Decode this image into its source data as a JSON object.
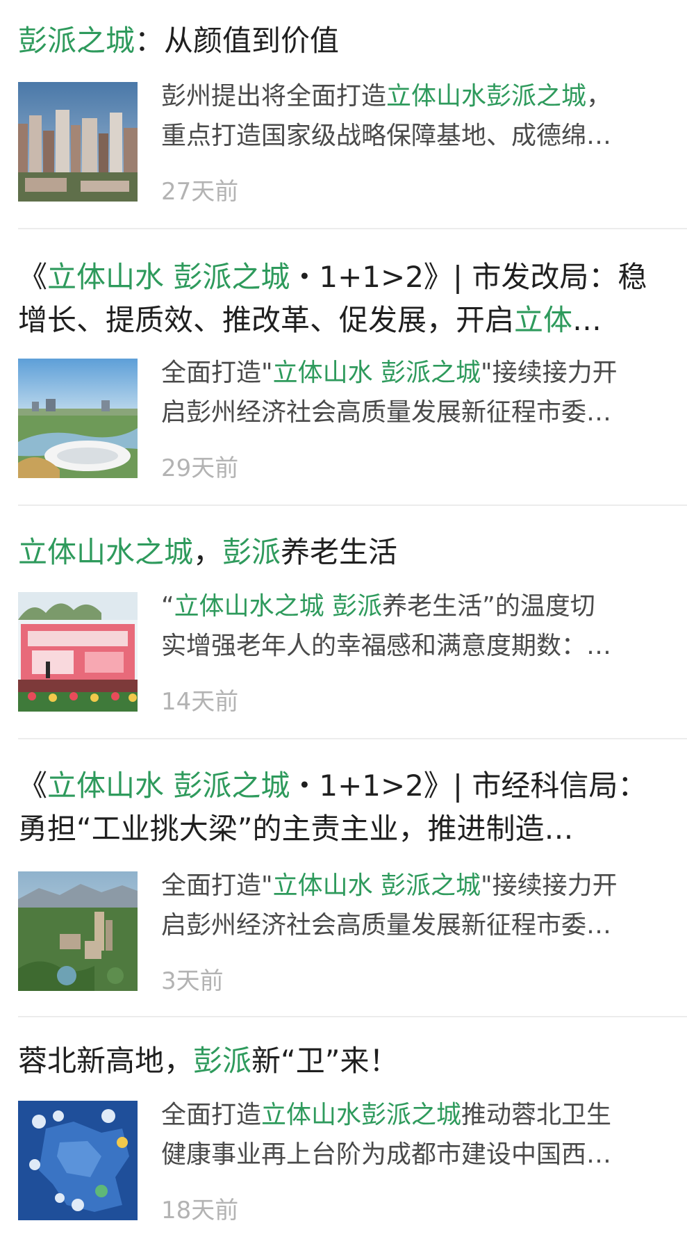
{
  "articles": [
    {
      "title_line1": [
        {
          "text": "彭派之城",
          "hl": true
        },
        {
          "text": "：从颜值到价值",
          "hl": false
        }
      ],
      "title_line2": [],
      "summary_line1": [
        {
          "text": "彭州提出将全面打造",
          "hl": false
        },
        {
          "text": "立体山水彭派之城",
          "hl": true
        },
        {
          "text": "，",
          "hl": false
        }
      ],
      "summary_line2": [
        {
          "text": "重点打造国家级战略保障基地、成德绵…",
          "hl": false
        }
      ],
      "time": "27天前",
      "thumb": "city-skyline-image"
    },
    {
      "title_line1": [
        {
          "text": "《",
          "hl": false
        },
        {
          "text": "立体山水 彭派之城",
          "hl": true
        },
        {
          "text": "・1+1>2》| 市发改局：稳",
          "hl": false
        }
      ],
      "title_line2": [
        {
          "text": "增长、提质效、推改革、促发展，开启",
          "hl": false
        },
        {
          "text": "立体",
          "hl": true
        },
        {
          "text": "…",
          "hl": false
        }
      ],
      "summary_line1": [
        {
          "text": "全面打造\"",
          "hl": false
        },
        {
          "text": "立体山水 彭派之城",
          "hl": true
        },
        {
          "text": "\"接续接力开",
          "hl": false
        }
      ],
      "summary_line2": [
        {
          "text": "启彭州经济社会高质量发展新征程市委…",
          "hl": false
        }
      ],
      "time": "29天前",
      "thumb": "stadium-aerial-image"
    },
    {
      "title_line1": [
        {
          "text": "立体山水之城",
          "hl": true
        },
        {
          "text": "，",
          "hl": false
        },
        {
          "text": "彭派",
          "hl": true
        },
        {
          "text": "养老生活",
          "hl": false
        }
      ],
      "title_line2": [],
      "summary_line1": [
        {
          "text": "“",
          "hl": false
        },
        {
          "text": "立体山水之城 彭派",
          "hl": true
        },
        {
          "text": "养老生活”的温度切",
          "hl": false
        }
      ],
      "summary_line2": [
        {
          "text": "实增强老年人的幸福感和满意度期数：…",
          "hl": false
        }
      ],
      "time": "14天前",
      "thumb": "event-stage-image"
    },
    {
      "title_line1": [
        {
          "text": "《",
          "hl": false
        },
        {
          "text": "立体山水 彭派之城",
          "hl": true
        },
        {
          "text": "・1+1>2》| 市经科信局：",
          "hl": false
        }
      ],
      "title_line2": [
        {
          "text": "勇担“工业挑大梁”的主责主业，推进制造…",
          "hl": false
        }
      ],
      "summary_line1": [
        {
          "text": "全面打造\"",
          "hl": false
        },
        {
          "text": "立体山水 彭派之城",
          "hl": true
        },
        {
          "text": "\"接续接力开",
          "hl": false
        }
      ],
      "summary_line2": [
        {
          "text": "启彭州经济社会高质量发展新征程市委…",
          "hl": false
        }
      ],
      "time": "3天前",
      "thumb": "mountain-city-image"
    },
    {
      "title_line1": [
        {
          "text": "蓉北新高地，",
          "hl": false
        },
        {
          "text": "彭派",
          "hl": true
        },
        {
          "text": "新“卫”来！",
          "hl": false
        }
      ],
      "title_line2": [],
      "summary_line1": [
        {
          "text": "全面打造",
          "hl": false
        },
        {
          "text": "立体山水彭派之城",
          "hl": true
        },
        {
          "text": "推动蓉北卫生",
          "hl": false
        }
      ],
      "summary_line2": [
        {
          "text": "健康事业再上台阶为成都市建设中国西…",
          "hl": false
        }
      ],
      "time": "18天前",
      "thumb": "health-map-image"
    }
  ],
  "colors": {
    "highlight": "#2e9a5c",
    "title": "#1f1f1f",
    "summary": "#4a4a4a",
    "time": "#b3b3b3",
    "divider": "#ececec"
  }
}
